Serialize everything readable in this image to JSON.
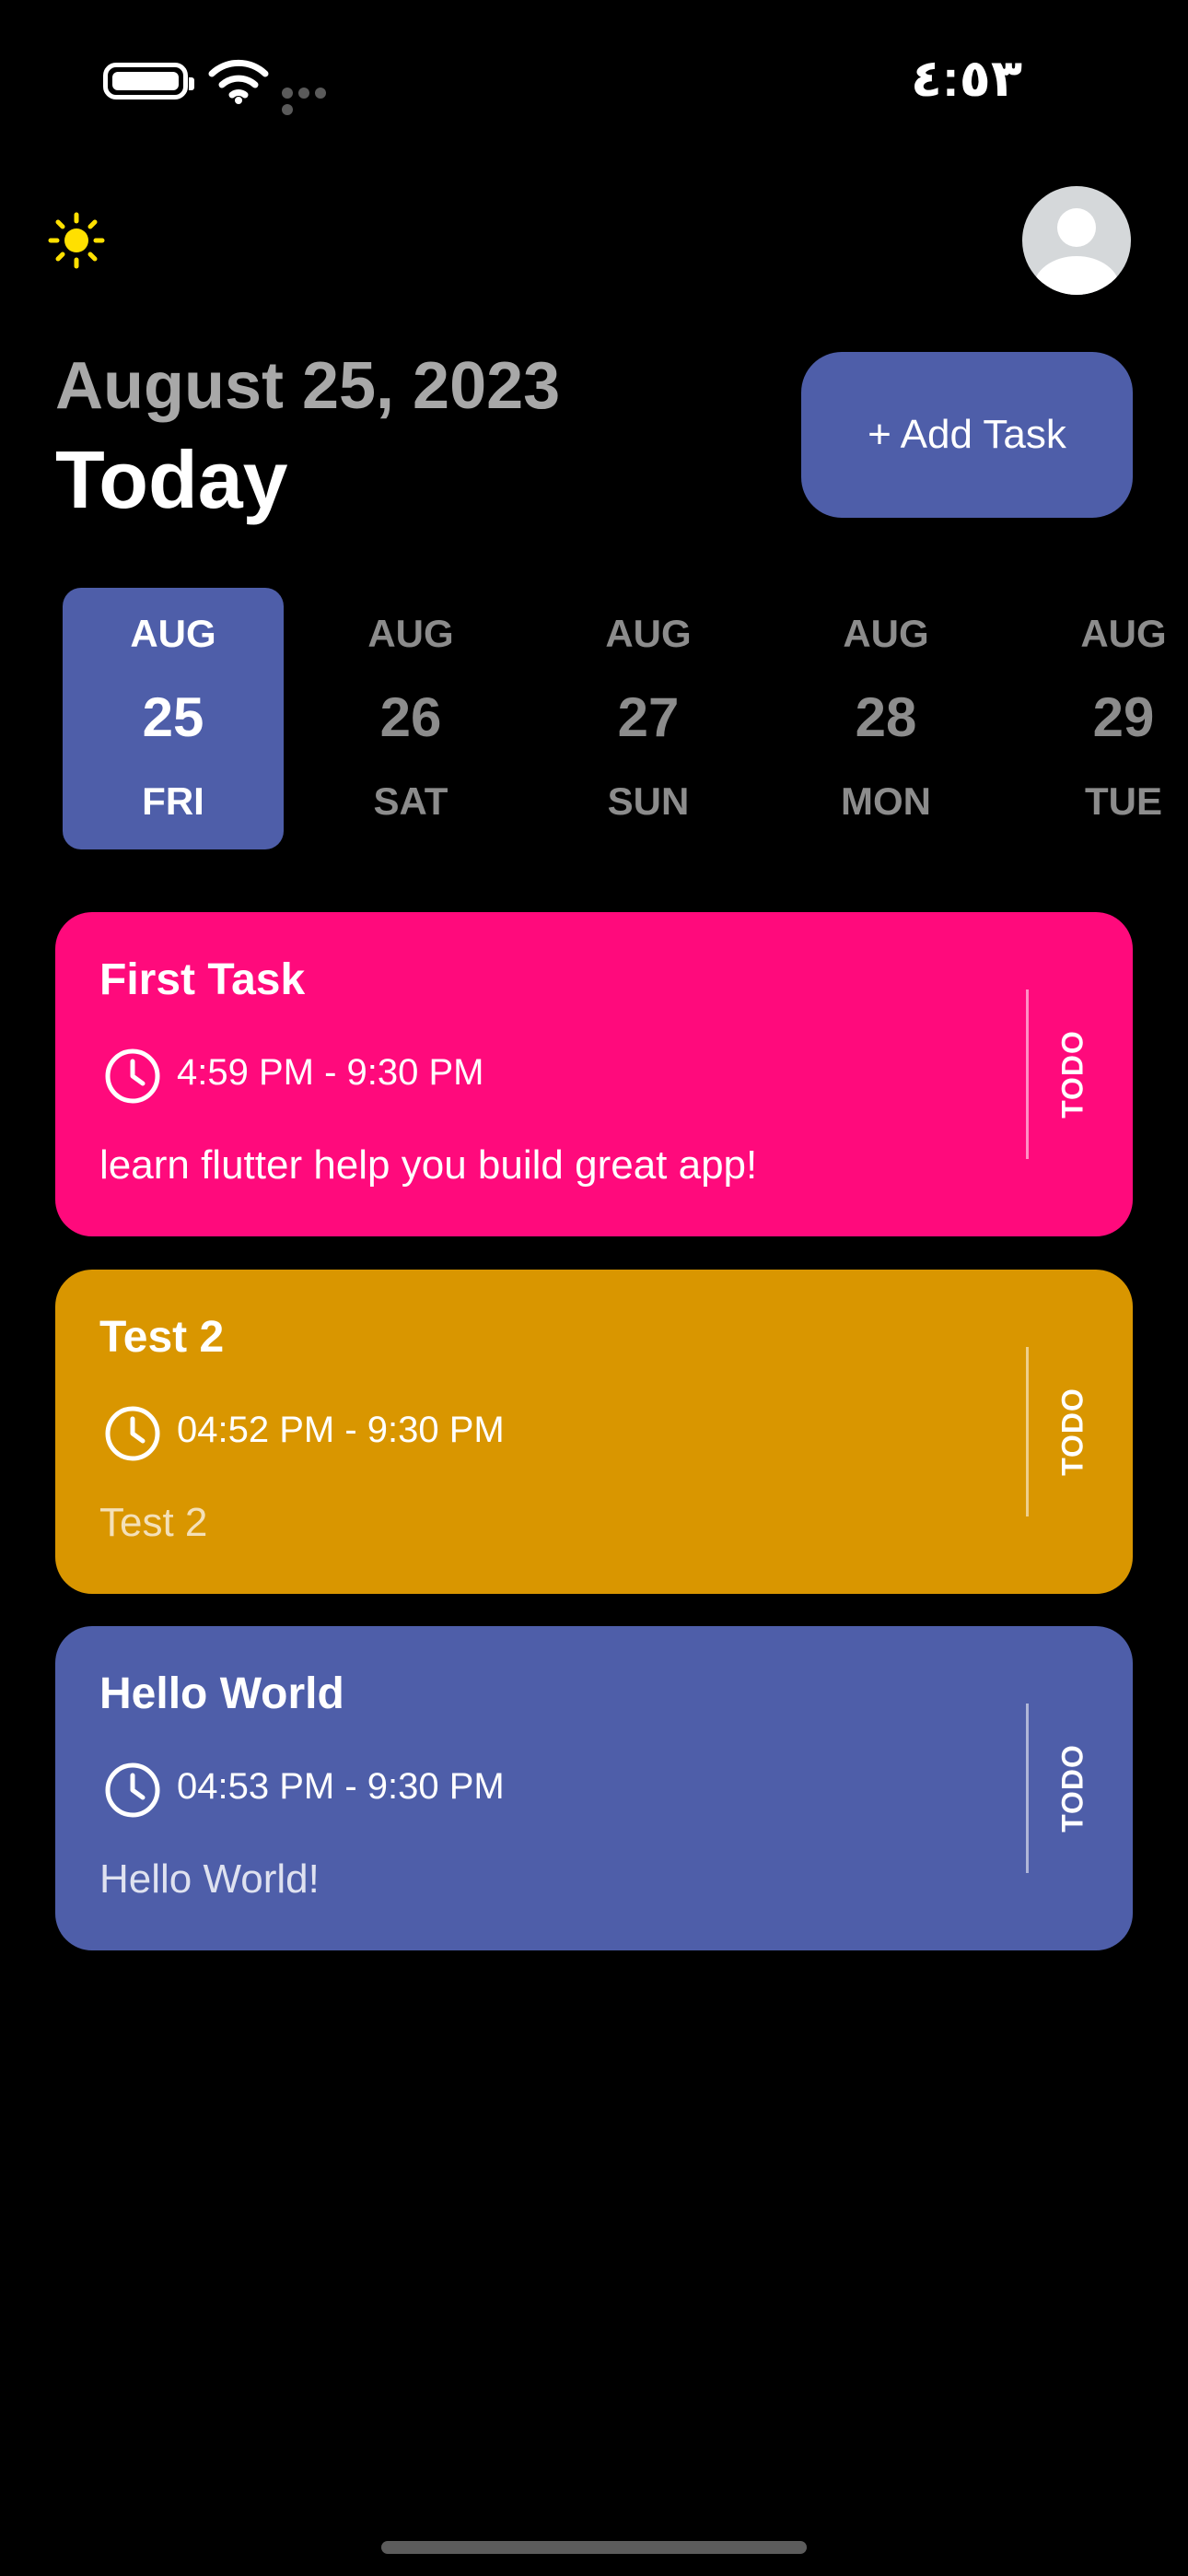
{
  "status_bar": {
    "time": "٤:٥٣"
  },
  "header": {
    "date": "August 25, 2023",
    "today": "Today",
    "add_task_label": "+ Add Task",
    "theme_icon": "sun-icon",
    "avatar_icon": "user-avatar-icon"
  },
  "date_strip": {
    "selected_index": 0,
    "dates": [
      {
        "month": "AUG",
        "day": "25",
        "weekday": "FRI"
      },
      {
        "month": "AUG",
        "day": "26",
        "weekday": "SAT"
      },
      {
        "month": "AUG",
        "day": "27",
        "weekday": "SUN"
      },
      {
        "month": "AUG",
        "day": "28",
        "weekday": "MON"
      },
      {
        "month": "AUG",
        "day": "29",
        "weekday": "TUE"
      }
    ]
  },
  "tasks": [
    {
      "title": "First Task",
      "time": "4:59 PM - 9:30 PM",
      "description": "learn flutter help you build great app!",
      "status": "TODO",
      "color": "#ff0a7c",
      "description_color": "#ffffff"
    },
    {
      "title": "Test 2",
      "time": "04:52 PM - 9:30 PM",
      "description": "Test 2",
      "status": "TODO",
      "color": "#d99600",
      "description_color": "#f4e0b8"
    },
    {
      "title": "Hello World",
      "time": "04:53 PM - 9:30 PM",
      "description": "Hello World!",
      "status": "TODO",
      "color": "#4e5ea9",
      "description_color": "#dfe2f0"
    }
  ],
  "colors": {
    "background": "#000000",
    "accent": "#4e5ea9",
    "muted_text": "#a8a8a8",
    "sun": "#ffe000"
  }
}
